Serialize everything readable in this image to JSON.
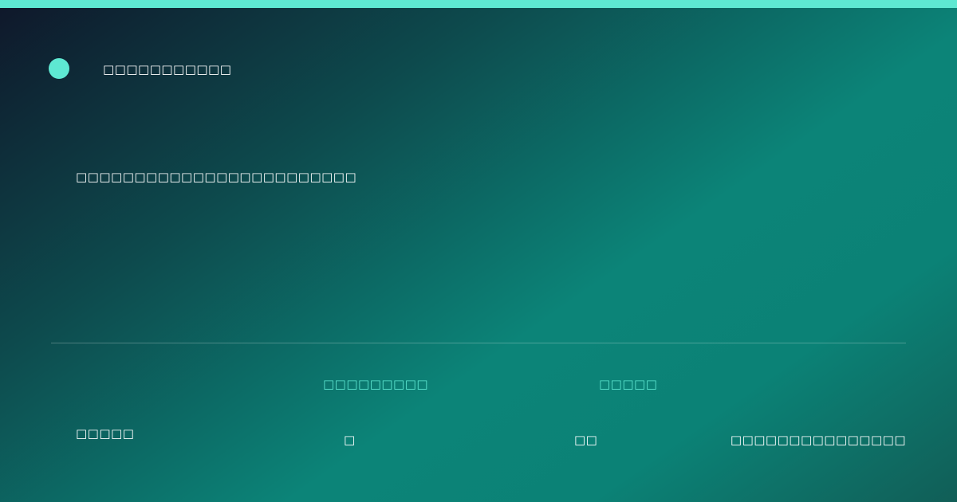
{
  "brand": {
    "name": "□□□□□□□□□□□"
  },
  "headline": {
    "text": "□□□□□□□□□□□□□□□□□□□□□□□□"
  },
  "stats": [
    {
      "label": "□□□□□□□□□",
      "value": "□"
    },
    {
      "label": "□□□□□",
      "value": "□□"
    }
  ],
  "footer": {
    "left": "□□□□□",
    "right": "□□□□□□□□□□□□□□□"
  },
  "colors": {
    "accent": "#5ee8d2",
    "background_start": "#0f172a",
    "background_mid": "#0c8478",
    "background_end": "#115e57",
    "text": "#ffffff"
  }
}
